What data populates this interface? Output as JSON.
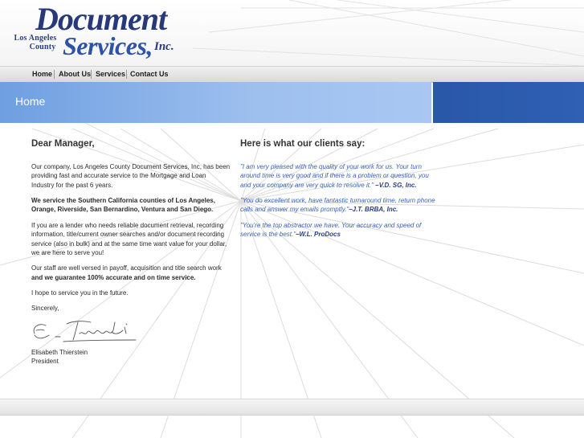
{
  "logo": {
    "county_line1": "Los Angeles",
    "county_line2": "County",
    "word1": "Document",
    "word2": "Services,",
    "suffix": "Inc."
  },
  "nav": {
    "items": [
      {
        "label": "Home"
      },
      {
        "label": "About Us"
      },
      {
        "label": "Services"
      },
      {
        "label": "Contact Us"
      }
    ]
  },
  "banner": {
    "title": "Home"
  },
  "letter": {
    "heading": "Dear Manager,",
    "p1": "Our company, Los Angeles County Document Services, Inc, has been providing fast and accurate service to the Mortgage and Loan Industry for the past 6 years.",
    "p2_bold": "We service the Southern California counties of Los Angeles, Orange, Riverside, San Bernardino, Ventura and San Diego.",
    "p3": "If you are a lender who needs reliable document retrieval, recording information, title/current owner searches and/or document recording service (also in bulk) and at the same time want value for your dollar, we are here to serve you!",
    "p4_normal": "Our staff are well versed in payoff, acquisition and title search work",
    "p4_bold": "and we guarantee 100% accurate and on time service.",
    "p5": "I hope to service you in the future.",
    "closing": "Sincerely,",
    "signer_name": "Elisabeth Thierstein",
    "signer_title": "President"
  },
  "testimonials": {
    "heading": "Here is what our clients say:",
    "items": [
      {
        "quote": "\"I am very pleased with the quality of your work for us. Your turn around time is very good and if there is a problem or question, you and your company are very quick to resolve it.\"",
        "author": "–V.D. SG, Inc."
      },
      {
        "quote": "\"You do excellent work, have fantastic turnaround time, return phone calls and answer my emails promptly.\"",
        "author": "–J.T. BRBA, Inc."
      },
      {
        "quote": "\"You're the top abstractor we have. Your accuracy and speed of service is the best.\"",
        "author": "–W.L. ProDocs"
      }
    ]
  },
  "colors": {
    "banner_light": "#9ec0ef",
    "banner_dark": "#2a57a8",
    "quote_blue": "#3b62b5",
    "logo_navy": "#27397a"
  }
}
